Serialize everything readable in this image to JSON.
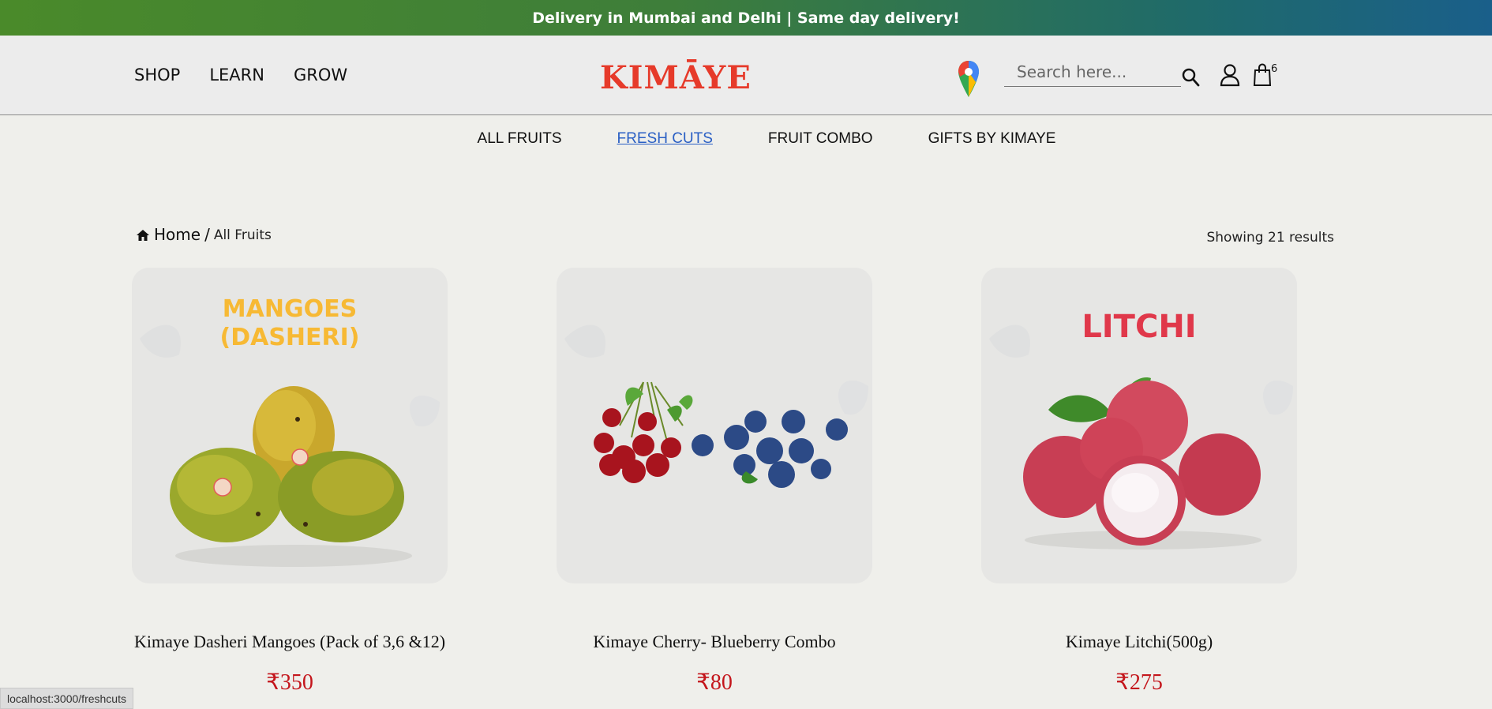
{
  "announcement": "Delivery in Mumbai and Delhi | Same day delivery!",
  "header": {
    "nav": [
      "SHOP",
      "LEARN",
      "GROW"
    ],
    "logo": "KIMĀYE",
    "search_placeholder": "Search here...",
    "cart_count": "6"
  },
  "subnav": {
    "items": [
      "ALL FRUITS",
      "FRESH CUTS",
      "FRUIT COMBO",
      "GIFTS BY KIMAYE"
    ],
    "active": "FRESH CUTS"
  },
  "breadcrumb": {
    "home": "Home",
    "separator": "/",
    "current": "All Fruits"
  },
  "results_text": "Showing 21 results",
  "products": [
    {
      "image_label": "MANGOES\n(DASHERI)",
      "name": "Kimaye Dasheri Mangoes (Pack of 3,6 &12)",
      "price": "₹350"
    },
    {
      "image_label": "",
      "name": "Kimaye Cherry- Blueberry Combo",
      "price": "₹80"
    },
    {
      "image_label": "LITCHI",
      "name": "Kimaye Litchi(500g)",
      "price": "₹275"
    }
  ],
  "status_url": "localhost:3000/freshcuts",
  "colors": {
    "accent_red": "#c4161c",
    "link_blue": "#2a5fc4",
    "logo_red": "#e63a2a",
    "leaf_green": "#6cb33e"
  }
}
